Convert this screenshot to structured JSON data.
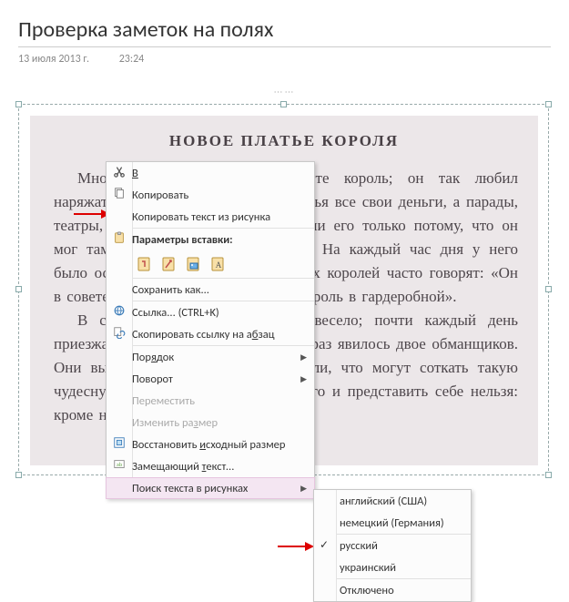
{
  "page": {
    "title": "Проверка заметок на полях",
    "date": "13 июля 2013 г.",
    "time": "23:24"
  },
  "image_content": {
    "title": "НОВОЕ ПЛАТЬЕ КОРОЛЯ",
    "para1": "Много лет назад жил на свете король; он так любил наряжаться, что тратил на новые платья все свои деньги, а парады, театры, загородные прогулки занимали его только потому, что он мог там показаться в новом наряде. На каждый час дня у него было особое платье, и как про других королей часто говорят: «Он в совете», так про него говорили: «Король в гардеробной».",
    "para2": "В столице короля было очень весело; почти каждый день приезжали иностранные гости, и вот раз явилось двое обманщиков. Они выдали себя за ткачей и сказали, что могут соткать такую чудесную ткань, лучше которой ничего и представить себе нельзя: кроме необыкно-"
  },
  "menu": {
    "cut": "Вырезать",
    "copy": "Копировать",
    "copy_text_from_image": "Копировать текст из рисунка",
    "paste_options_header": "Параметры вставки:",
    "save_as": "Сохранить как...",
    "link_shortcut": "(CTRL+K)",
    "link_label": "Ссылка...  ",
    "copy_link_to_paragraph": "Скопировать ссылку на абзац",
    "order": "Порядок",
    "rotate": "Поворот",
    "move": "Переместить",
    "resize": "Изменить размер",
    "restore_original_size": "Восстановить исходный размер",
    "alt_text": "Замещающий текст...",
    "ocr_lang": "Поиск текста в рисунках"
  },
  "submenu": {
    "en": "английский (США)",
    "de": "немецкий (Германия)",
    "ru": "русский",
    "uk": "украинский",
    "off": "Отключено"
  },
  "paste_options": [
    {
      "name": "paste-keep-formatting-icon"
    },
    {
      "name": "paste-merge-icon"
    },
    {
      "name": "paste-picture-icon"
    },
    {
      "name": "paste-text-only-icon"
    }
  ]
}
